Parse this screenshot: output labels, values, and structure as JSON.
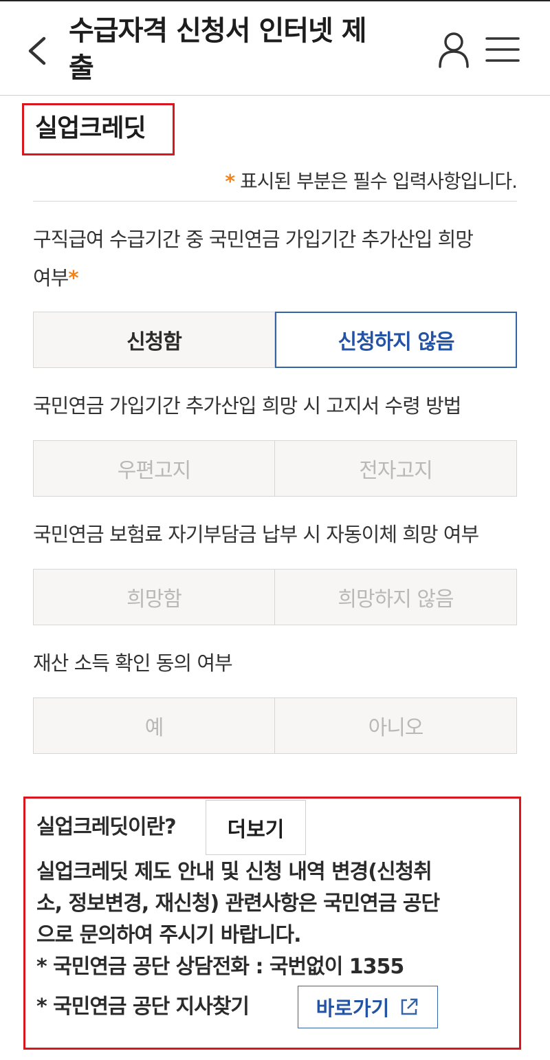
{
  "header": {
    "title_line1": "수급자격 신청서 인터넷 제",
    "title_line2": "출"
  },
  "section": {
    "title": "실업크레딧",
    "required_star": "*",
    "required_note": "표시된 부분은 필수 입력사항입니다."
  },
  "questions": [
    {
      "label_line1": "구직급여 수급기간 중 국민연금 가입기간 추가산입 희망",
      "label_line2": "여부",
      "required_mark": "*",
      "options": [
        "신청함",
        "신청하지 않음"
      ],
      "selected": "신청하지 않음"
    },
    {
      "label": "국민연금 가입기간 추가산입 희망 시 고지서 수령 방법",
      "options": [
        "우편고지",
        "전자고지"
      ]
    },
    {
      "label": "국민연금 보험료 자기부담금 납부 시 자동이체 희망 여부",
      "options": [
        "희망함",
        "희망하지 않음"
      ]
    },
    {
      "label": "재산 소득 확인 동의 여부",
      "options": [
        "예",
        "아니오"
      ]
    }
  ],
  "info": {
    "heading": "실업크레딧이란?",
    "more_button": "더보기",
    "body_line1": "실업크레딧 제도 안내 및 신청 내역 변경(신청취",
    "body_line2": "소, 정보변경, 재신청) 관련사항은 국민연금 공단",
    "body_line3": "으로 문의하여 주시기 바랍니다.",
    "phone_line": "* 국민연금 공단 상담전화 : 국번없이 1355",
    "branch_line": "* 국민연금 공단 지사찾기",
    "go_button": "바로가기"
  },
  "icons": {
    "back": "chevron-left-icon",
    "user": "user-icon",
    "menu": "hamburger-menu-icon",
    "external": "external-link-icon"
  },
  "colors": {
    "accent_blue": "#2553a4",
    "required_orange": "#f08219",
    "highlight_red": "#d9161d"
  }
}
